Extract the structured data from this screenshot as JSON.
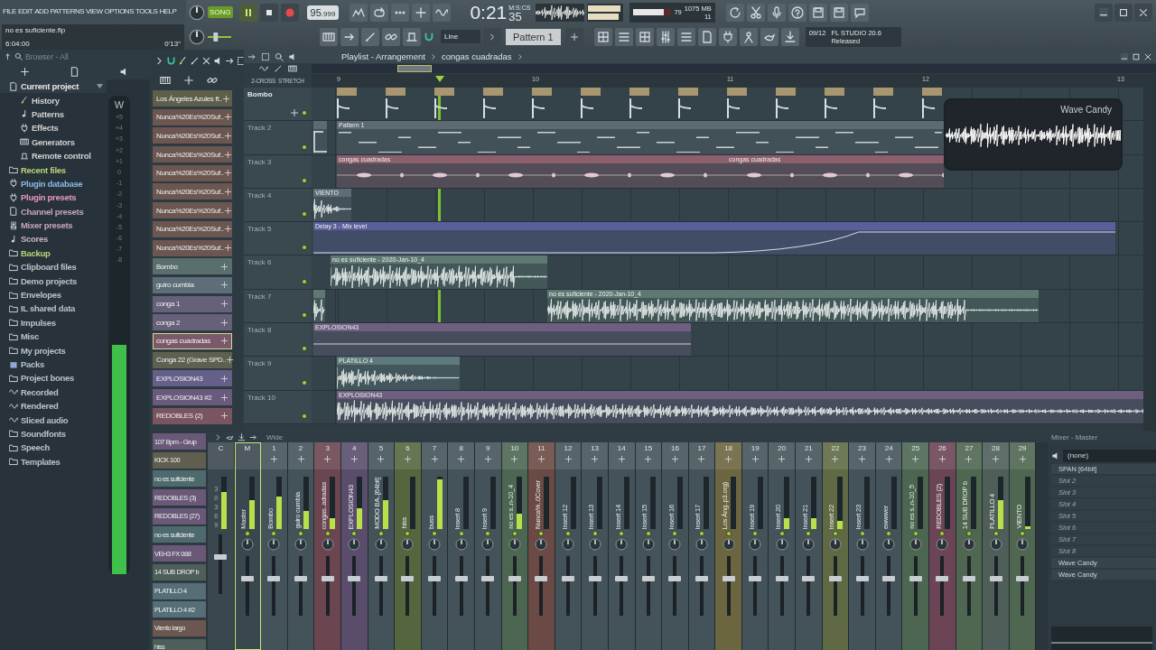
{
  "menu": [
    "FILE",
    "EDIT",
    "ADD",
    "PATTERNS",
    "VIEW",
    "OPTIONS",
    "TOOLS",
    "HELP"
  ],
  "project": {
    "file": "no es suficiente.flp",
    "length": "6:04:00",
    "elapsed": "0'13\""
  },
  "transport": {
    "mode": "SONG",
    "playing": true,
    "tempo": "95",
    "tempo_fraction": ".999"
  },
  "time": {
    "value": "0:21",
    "fraction": "35",
    "unit": "M:S:CS"
  },
  "monitor": {
    "cpu": "79",
    "level": 0.79,
    "memory": "1075 MB",
    "polyphony": "11"
  },
  "pitch": {
    "level": 0.3
  },
  "snap": "Line",
  "pattern": "Pattern 1",
  "hint": {
    "counter": "09/12",
    "title": "FL STUDIO 20.6",
    "subtitle": "Released"
  },
  "browser": {
    "title": "Browser - All",
    "items": [
      {
        "label": "Current project",
        "kind": "project",
        "color": "#e6e6e6",
        "expanded": true,
        "children": [
          {
            "label": "History",
            "kind": "history",
            "color": "#cfcfcf"
          },
          {
            "label": "Patterns",
            "kind": "note",
            "color": "#cfcfcf"
          },
          {
            "label": "Effects",
            "kind": "effect",
            "color": "#cfcfcf"
          },
          {
            "label": "Generators",
            "kind": "piano",
            "color": "#cfcfcf"
          },
          {
            "label": "Remote control",
            "kind": "remote",
            "color": "#cfcfcf"
          }
        ]
      },
      {
        "label": "Recent files",
        "kind": "recent",
        "color": "#b9d67a"
      },
      {
        "label": "Plugin database",
        "kind": "plugin",
        "color": "#8db8e8"
      },
      {
        "label": "Plugin presets",
        "kind": "plugin",
        "color": "#e89ab8"
      },
      {
        "label": "Channel presets",
        "kind": "channel",
        "color": "#c7a6b8"
      },
      {
        "label": "Mixer presets",
        "kind": "mixer",
        "color": "#c7a6b8"
      },
      {
        "label": "Scores",
        "kind": "note",
        "color": "#c9b3c0"
      },
      {
        "label": "Backup",
        "kind": "recent",
        "color": "#b9d67a"
      },
      {
        "label": "Clipboard files",
        "kind": "folder",
        "color": "#b7c3c9"
      },
      {
        "label": "Demo projects",
        "kind": "folder",
        "color": "#b7c3c9"
      },
      {
        "label": "Envelopes",
        "kind": "folder",
        "color": "#b7c3c9"
      },
      {
        "label": "IL shared data",
        "kind": "folder",
        "color": "#b7c3c9"
      },
      {
        "label": "Impulses",
        "kind": "folder",
        "color": "#b7c3c9"
      },
      {
        "label": "Misc",
        "kind": "folder",
        "color": "#b7c3c9"
      },
      {
        "label": "My projects",
        "kind": "folder",
        "color": "#b7c3c9"
      },
      {
        "label": "Packs",
        "kind": "packs",
        "color": "#b7c3c9"
      },
      {
        "label": "Project bones",
        "kind": "folder",
        "color": "#b7c3c9"
      },
      {
        "label": "Recorded",
        "kind": "wave",
        "color": "#b7c3c9"
      },
      {
        "label": "Rendered",
        "kind": "wave",
        "color": "#b7c3c9"
      },
      {
        "label": "Sliced audio",
        "kind": "wave",
        "color": "#b7c3c9"
      },
      {
        "label": "Soundfonts",
        "kind": "folder",
        "color": "#b7c3c9"
      },
      {
        "label": "Speech",
        "kind": "folder",
        "color": "#b7c3c9"
      },
      {
        "label": "Templates",
        "kind": "folder",
        "color": "#b7c3c9"
      }
    ],
    "meter": {
      "label": "W",
      "scale": [
        "+5",
        "+4",
        "+3",
        "+2",
        "+1",
        "0",
        "-1",
        "-2",
        "-3",
        "-4",
        "-5",
        "-6",
        "-7",
        "-8"
      ],
      "level": 0.53
    }
  },
  "channels": [
    {
      "name": "Los Ángeles Azules ft..",
      "color": "#5e5e4a",
      "selected": false
    },
    {
      "name": "Nunca%20Es%20Suf..",
      "color": "#6b5650",
      "selected": false
    },
    {
      "name": "Nunca%20Es%20Suf..",
      "color": "#6b5650",
      "selected": false
    },
    {
      "name": "Nunca%20Es%20Suf..",
      "color": "#6b5650",
      "selected": false
    },
    {
      "name": "Nunca%20Es%20Suf..",
      "color": "#6b5650",
      "selected": false
    },
    {
      "name": "Nunca%20Es%20Suf..",
      "color": "#6b5650",
      "selected": false
    },
    {
      "name": "Nunca%20Es%20Suf..",
      "color": "#6b5650",
      "selected": false
    },
    {
      "name": "Nunca%20Es%20Suf..",
      "color": "#6b5650",
      "selected": false
    },
    {
      "name": "Nunca%20Es%20Suf..",
      "color": "#6b5650",
      "selected": false
    },
    {
      "name": "Bombo",
      "color": "#5a6e6e",
      "selected": false
    },
    {
      "name": "guiro cumbia",
      "color": "#5d6e78",
      "selected": false
    },
    {
      "name": "conga 1",
      "color": "#66607a",
      "selected": false
    },
    {
      "name": "conga 2",
      "color": "#66607a",
      "selected": false
    },
    {
      "name": "congas cuadradas",
      "color": "#7a5a6a",
      "selected": true
    },
    {
      "name": "Conga 22 (Grave SPD..",
      "color": "#5e6150",
      "selected": false
    },
    {
      "name": "EXPLOSION43",
      "color": "#65608a",
      "selected": false
    },
    {
      "name": "EXPLOSION43 #2",
      "color": "#6a5a7c",
      "selected": false
    },
    {
      "name": "REDOBLES (2)",
      "color": "#7a5560",
      "selected": false
    },
    {
      "name": "107 Bpm - Grup",
      "color": "#6a5878",
      "selected": false
    },
    {
      "name": "KICK 100",
      "color": "#605e4e",
      "selected": false
    },
    {
      "name": "no es suficiente",
      "color": "#4f6a6e",
      "selected": false
    },
    {
      "name": "REDOBLES (3)",
      "color": "#6a5878",
      "selected": false
    },
    {
      "name": "REDOBLES (27)",
      "color": "#6a5878",
      "selected": false
    },
    {
      "name": "no es suficiente",
      "color": "#4f6a6e",
      "selected": false
    },
    {
      "name": "VEH3 FX 088",
      "color": "#6a5878",
      "selected": false
    },
    {
      "name": "14 SUB DROP b",
      "color": "#4e5e58",
      "selected": false
    },
    {
      "name": "PLATILLO 4",
      "color": "#566e78",
      "selected": false
    },
    {
      "name": "PLATILLO 4 #2",
      "color": "#566e78",
      "selected": false
    },
    {
      "name": "Viento largo",
      "color": "#6b5650",
      "selected": false
    },
    {
      "name": "hiss",
      "color": "#4e5e58",
      "selected": false
    }
  ],
  "playlist": {
    "title": "Playlist - Arrangement",
    "breadcrumb": "congas cuadradas",
    "options": [
      "2-CROSS",
      "STRETCH"
    ],
    "ruler": [
      "9",
      "10",
      "11",
      "12",
      "13"
    ],
    "tracks": [
      {
        "name": "Bombo",
        "renamed": true,
        "clips": [
          {
            "kind": "sample",
            "color": "#a89670"
          },
          {
            "kind": "sample",
            "color": "#a89670"
          },
          {
            "kind": "sample",
            "color": "#a89670"
          },
          {
            "kind": "sample",
            "color": "#a89670"
          },
          {
            "kind": "sample",
            "color": "#a89670"
          },
          {
            "kind": "sample",
            "color": "#a89670"
          },
          {
            "kind": "sample",
            "color": "#a89670"
          },
          {
            "kind": "sample",
            "color": "#a89670"
          },
          {
            "kind": "sample",
            "color": "#a89670"
          },
          {
            "kind": "sample",
            "color": "#a89670"
          },
          {
            "kind": "sample",
            "color": "#a89670"
          },
          {
            "kind": "sample",
            "color": "#a89670"
          },
          {
            "kind": "sample",
            "color": "#a89670"
          }
        ]
      },
      {
        "name": "Track 2",
        "renamed": false,
        "clips": [
          {
            "kind": "pattern",
            "color": "#5c6a72"
          },
          {
            "kind": "pattern",
            "label": "Pattern 1",
            "color": "#5c6a72"
          }
        ]
      },
      {
        "name": "Track 3",
        "renamed": false,
        "clips": [
          {
            "kind": "notes",
            "label": "congas cuadradas",
            "color": "#8c5f6e"
          },
          {
            "kind": "notes",
            "label": "congas cuadradas",
            "color": "#8c5f6e"
          }
        ]
      },
      {
        "name": "Track 4",
        "renamed": false,
        "clips": [
          {
            "kind": "audio",
            "label": "VIENTO",
            "color": "#5e6e78"
          }
        ]
      },
      {
        "name": "Track 5",
        "renamed": false,
        "clips": [
          {
            "kind": "automation",
            "label": "Delay 3 - Mix level",
            "color": "#5a5f9c"
          }
        ]
      },
      {
        "name": "Track 6",
        "renamed": false,
        "clips": [
          {
            "kind": "audio",
            "label": "no es suficiente - 2020-Jan-10_4",
            "color": "#5f7872"
          }
        ]
      },
      {
        "name": "Track 7",
        "renamed": false,
        "clips": [
          {
            "kind": "audio",
            "color": "#5f7872"
          },
          {
            "kind": "audio",
            "label": "no es suficiente - 2020-Jan-10_4",
            "color": "#5f7872"
          }
        ]
      },
      {
        "name": "Track 8",
        "renamed": false,
        "clips": [
          {
            "kind": "flat",
            "label": "EXPLOSION43",
            "color": "#6e5f80"
          }
        ]
      },
      {
        "name": "Track 9",
        "renamed": false,
        "clips": [
          {
            "kind": "audio",
            "label": "PLATILLO 4",
            "color": "#5f7a7c"
          }
        ]
      },
      {
        "name": "Track 10",
        "renamed": false,
        "clips": [
          {
            "kind": "audio",
            "label": "EXPLOSION43",
            "color": "#6e5f80"
          }
        ]
      }
    ],
    "plugin_window": {
      "title": "Wave Candy"
    }
  },
  "mixer": {
    "title": "Wide",
    "scale": [
      "3",
      "0",
      "3",
      "6",
      "9"
    ],
    "inserts": [
      {
        "number": "C",
        "kind": "current",
        "selected": false,
        "color": "#3a474e",
        "level": 0.7
      },
      {
        "number": "M",
        "name": "Master",
        "kind": "master",
        "selected": true,
        "color": "#3a474e",
        "level": 0.55
      },
      {
        "number": "1",
        "name": "Bombo",
        "kind": "insert",
        "selected": false,
        "color": "#44535a",
        "level": 0.62
      },
      {
        "number": "2",
        "name": "guiro cumbia",
        "kind": "insert",
        "selected": false,
        "color": "#44535a",
        "level": 0.35
      },
      {
        "number": "3",
        "name": "congas..adradas",
        "kind": "insert",
        "selected": false,
        "color": "#6b4650",
        "level": 0.2
      },
      {
        "number": "4",
        "name": "EXPLOSION43",
        "kind": "insert",
        "selected": false,
        "color": "#5a4d6b",
        "level": 0.4
      },
      {
        "number": "5",
        "name": "MODO BA..[64bit]",
        "kind": "insert",
        "selected": false,
        "color": "#44535a",
        "level": 0.55
      },
      {
        "number": "6",
        "name": "hiss",
        "kind": "insert",
        "selected": false,
        "color": "#55663f",
        "level": 0
      },
      {
        "number": "7",
        "name": "buss",
        "kind": "insert",
        "selected": false,
        "color": "#44535a",
        "level": 0.95
      },
      {
        "number": "8",
        "name": "Insert 8",
        "kind": "insert",
        "selected": false,
        "color": "#44535a",
        "level": 0
      },
      {
        "number": "9",
        "name": "Insert 9",
        "kind": "insert",
        "selected": false,
        "color": "#44535a",
        "level": 0
      },
      {
        "number": "10",
        "name": "no es s..n-10_4",
        "kind": "insert",
        "selected": false,
        "color": "#4d6652",
        "level": 0.3
      },
      {
        "number": "11",
        "name": "Nunca%..0Cover",
        "kind": "insert",
        "selected": false,
        "color": "#6b4a45",
        "level": 0
      },
      {
        "number": "12",
        "name": "Insert 12",
        "kind": "insert",
        "selected": false,
        "color": "#44535a",
        "level": 0
      },
      {
        "number": "13",
        "name": "Insert 13",
        "kind": "insert",
        "selected": false,
        "color": "#44535a",
        "level": 0
      },
      {
        "number": "14",
        "name": "Insert 14",
        "kind": "insert",
        "selected": false,
        "color": "#44535a",
        "level": 0
      },
      {
        "number": "15",
        "name": "Insert 15",
        "kind": "insert",
        "selected": false,
        "color": "#44535a",
        "level": 0
      },
      {
        "number": "16",
        "name": "Insert 16",
        "kind": "insert",
        "selected": false,
        "color": "#44535a",
        "level": 0
      },
      {
        "number": "17",
        "name": "Insert 17",
        "kind": "insert",
        "selected": false,
        "color": "#44535a",
        "level": 0
      },
      {
        "number": "18",
        "name": "Los Áng..p3.org)",
        "kind": "insert",
        "selected": false,
        "color": "#6b6540",
        "level": 0
      },
      {
        "number": "19",
        "name": "Insert 19",
        "kind": "insert",
        "selected": false,
        "color": "#44535a",
        "level": 0
      },
      {
        "number": "20",
        "name": "Insert 20",
        "kind": "insert",
        "selected": false,
        "color": "#44535a",
        "level": 0.2
      },
      {
        "number": "21",
        "name": "Insert 21",
        "kind": "insert",
        "selected": false,
        "color": "#44535a",
        "level": 0.2
      },
      {
        "number": "22",
        "name": "Insert 22",
        "kind": "insert",
        "selected": false,
        "color": "#5f6a45",
        "level": 0.15
      },
      {
        "number": "23",
        "name": "Insert 23",
        "kind": "insert",
        "selected": false,
        "color": "#44535a",
        "level": 0
      },
      {
        "number": "24",
        "name": "ewwwer",
        "kind": "insert",
        "selected": false,
        "color": "#44535a",
        "level": 0
      },
      {
        "number": "25",
        "name": "no es s..n-10_5",
        "kind": "insert",
        "selected": false,
        "color": "#4d6652",
        "level": 0
      },
      {
        "number": "26",
        "name": "REDOBLES (2)",
        "kind": "insert",
        "selected": false,
        "color": "#6b4556",
        "level": 0
      },
      {
        "number": "27",
        "name": "14 SUB DROP b",
        "kind": "insert",
        "selected": false,
        "color": "#4f6650",
        "level": 0
      },
      {
        "number": "28",
        "name": "PLATILLO 4",
        "kind": "insert",
        "selected": false,
        "color": "#4f5e58",
        "level": 0.55
      },
      {
        "number": "29",
        "name": "VIENTO",
        "kind": "insert",
        "selected": false,
        "color": "#4f6650",
        "level": 0.05
      }
    ],
    "panel": {
      "title": "Mixer - Master",
      "input": "(none)",
      "slots": [
        {
          "label": "SPAN [64bit]",
          "empty": false
        },
        {
          "label": "Slot 2",
          "empty": true
        },
        {
          "label": "Slot 3",
          "empty": true
        },
        {
          "label": "Slot 4",
          "empty": true
        },
        {
          "label": "Slot 5",
          "empty": true
        },
        {
          "label": "Slot 6",
          "empty": true
        },
        {
          "label": "Slot 7",
          "empty": true
        },
        {
          "label": "Slot 8",
          "empty": true
        },
        {
          "label": "Wave Candy",
          "empty": false
        },
        {
          "label": "Wave Candy",
          "empty": false
        }
      ]
    }
  }
}
